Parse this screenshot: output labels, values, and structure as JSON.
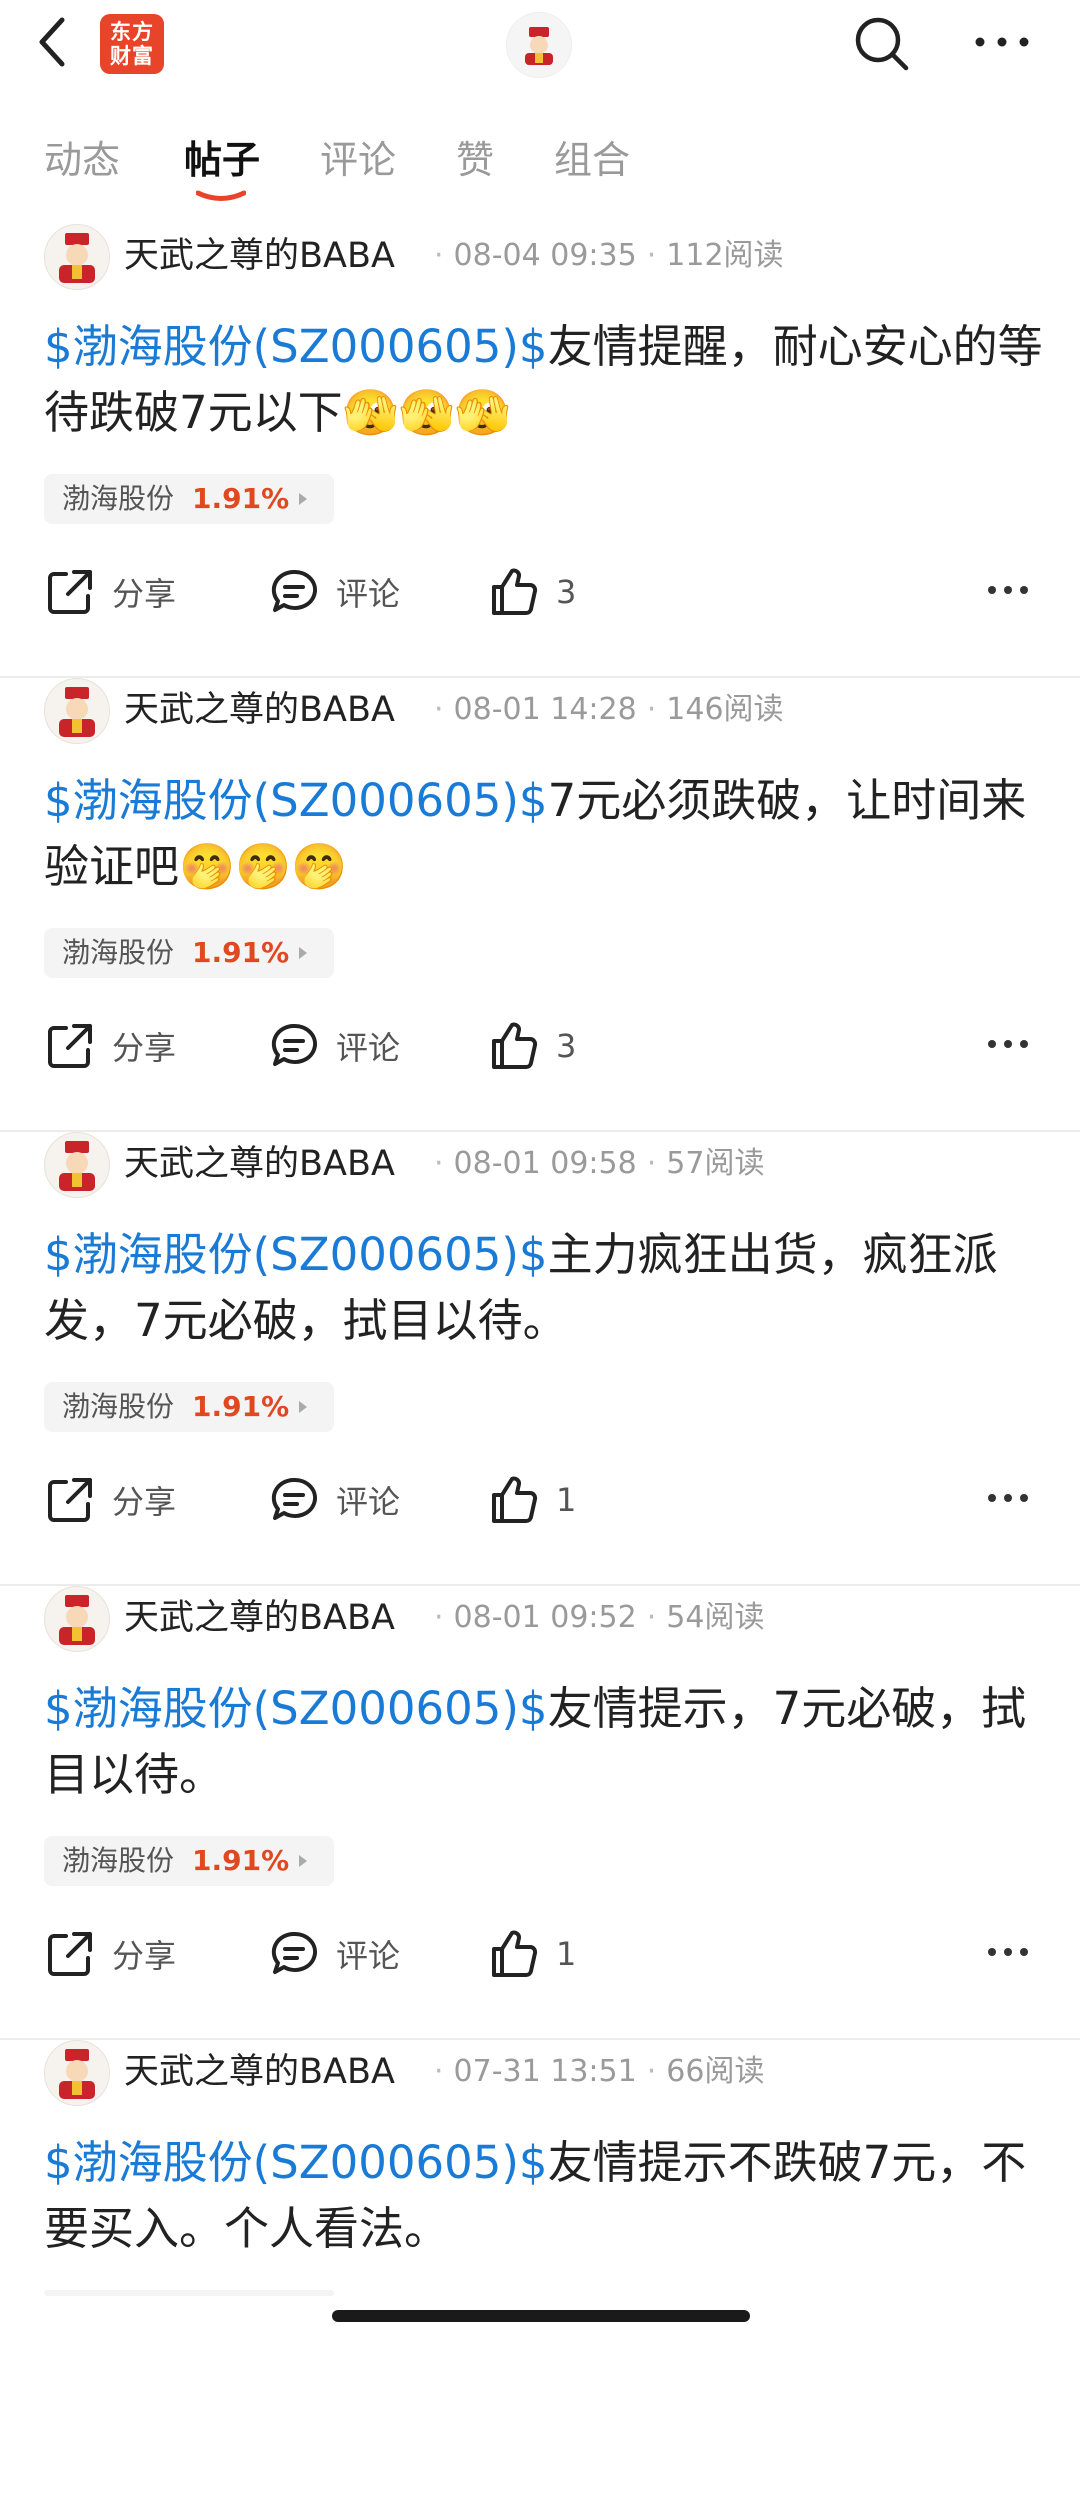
{
  "header": {
    "logo_line1": "东方",
    "logo_line2": "财富"
  },
  "tabs": [
    {
      "label": "动态"
    },
    {
      "label": "帖子"
    },
    {
      "label": "评论"
    },
    {
      "label": "赞"
    },
    {
      "label": "组合"
    }
  ],
  "active_tab": "帖子",
  "posts": [
    {
      "author": "天武之尊的BABA",
      "time": "08-04 09:35",
      "reads": "112阅读",
      "tag": "$渤海股份(SZ000605)$",
      "text": "友情提醒，耐心安心的等待跌破7元以下",
      "emoji": "🫣🫣🫣",
      "stock_name": "渤海股份",
      "stock_pct": "1.91%",
      "share_label": "分享",
      "comment_label": "评论",
      "likes": "3"
    },
    {
      "author": "天武之尊的BABA",
      "time": "08-01 14:28",
      "reads": "146阅读",
      "tag": "$渤海股份(SZ000605)$",
      "text": "7元必须跌破，让时间来验证吧",
      "emoji": "🤭🤭🤭",
      "stock_name": "渤海股份",
      "stock_pct": "1.91%",
      "share_label": "分享",
      "comment_label": "评论",
      "likes": "3"
    },
    {
      "author": "天武之尊的BABA",
      "time": "08-01 09:58",
      "reads": "57阅读",
      "tag": "$渤海股份(SZ000605)$",
      "text": "主力疯狂出货，疯狂派发，7元必破，拭目以待。",
      "emoji": "",
      "stock_name": "渤海股份",
      "stock_pct": "1.91%",
      "share_label": "分享",
      "comment_label": "评论",
      "likes": "1"
    },
    {
      "author": "天武之尊的BABA",
      "time": "08-01 09:52",
      "reads": "54阅读",
      "tag": "$渤海股份(SZ000605)$",
      "text": "友情提示，7元必破，拭目以待。",
      "emoji": "",
      "stock_name": "渤海股份",
      "stock_pct": "1.91%",
      "share_label": "分享",
      "comment_label": "评论",
      "likes": "1"
    },
    {
      "author": "天武之尊的BABA",
      "time": "07-31 13:51",
      "reads": "66阅读",
      "tag": "$渤海股份(SZ000605)$",
      "text": "友情提示不跌破7元，不要买入。个人看法。",
      "emoji": ""
    }
  ],
  "colors": {
    "accent": "#e8442a",
    "link": "#1a7bd6",
    "up": "#e0481f"
  }
}
